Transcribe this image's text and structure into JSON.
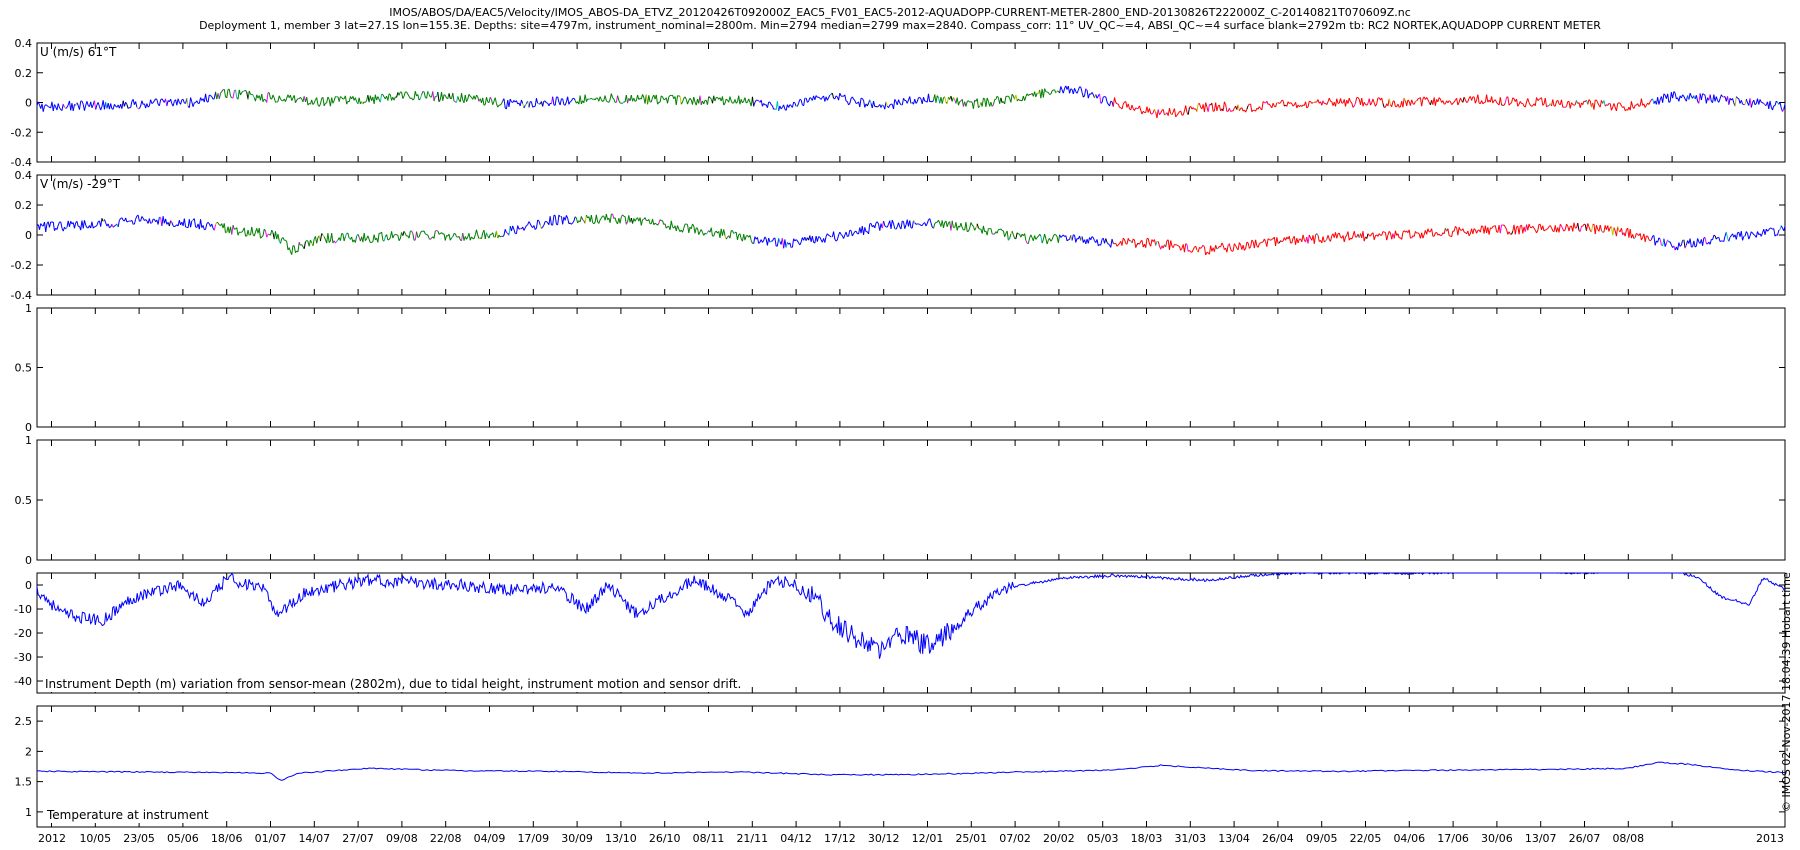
{
  "header": {
    "title_line1": "IMOS/ABOS/DA/EAC5/Velocity/IMOS_ABOS-DA_ETVZ_20120426T092000Z_EAC5_FV01_EAC5-2012-AQUADOPP-CURRENT-METER-2800_END-20130826T222000Z_C-20140821T070609Z.nc",
    "title_line2": "Deployment 1, member 3 lat=27.1S lon=155.3E. Depths: site=4797m, instrument_nominal=2800m. Min=2794 median=2799 max=2840. Compass_corr: 11° UV_QC~=4, ABSI_QC~=4 surface blank=2792m tb: RC2 NORTEK,AQUADOPP CURRENT METER"
  },
  "side_label": "© IMOS 02-Nov-2017 18:04:39 Hobart time",
  "colors": {
    "blue": "#0000ff",
    "green": "#007f00",
    "red": "#ff0000",
    "magenta": "#ff00ff",
    "cyan": "#00bfbf",
    "olive": "#bfbf00",
    "black": "#000000"
  },
  "chart_data": [
    {
      "type": "line",
      "panel": "U",
      "label": "U (m/s) 61°T",
      "xlim": [
        "2012-04-26",
        "2013-08-26"
      ],
      "ylim": [
        -0.4,
        0.4
      ],
      "yticks": [
        "0.4",
        "0.2",
        "0",
        "-0.2",
        "-0.4"
      ],
      "grid": false,
      "series": [
        {
          "color": "mixed (blue, green, red, magenta, cyan, olive, black by sample)",
          "x": [
            "2012-04-26",
            "2012-05-10",
            "2012-05-25",
            "2012-06-08",
            "2012-06-18",
            "2012-07-01",
            "2012-07-14",
            "2012-07-27",
            "2012-08-09",
            "2012-08-22",
            "2012-09-04",
            "2012-09-17",
            "2012-09-30",
            "2012-10-13",
            "2012-10-26",
            "2012-11-08",
            "2012-11-21",
            "2012-12-04",
            "2012-12-17",
            "2012-12-30",
            "2013-01-12",
            "2013-01-25",
            "2013-02-07",
            "2013-02-20",
            "2013-03-05",
            "2013-03-18",
            "2013-03-31",
            "2013-04-13",
            "2013-04-26",
            "2013-05-09",
            "2013-05-22",
            "2013-06-04",
            "2013-06-17",
            "2013-06-30",
            "2013-07-13",
            "2013-07-26",
            "2013-08-08",
            "2013-08-26"
          ],
          "values": [
            -0.03,
            -0.02,
            -0.01,
            0.0,
            0.06,
            0.03,
            0.0,
            0.02,
            0.05,
            0.03,
            -0.01,
            0.01,
            0.03,
            0.02,
            0.01,
            0.02,
            -0.03,
            0.04,
            -0.03,
            0.03,
            -0.01,
            0.03,
            0.1,
            0.0,
            -0.08,
            -0.03,
            -0.03,
            -0.01,
            0.0,
            0.0,
            0.01,
            0.02,
            0.0,
            -0.01,
            -0.03,
            0.04,
            0.02,
            -0.03
          ]
        }
      ]
    },
    {
      "type": "line",
      "panel": "V",
      "label": "V (m/s) -29°T",
      "xlim": [
        "2012-04-26",
        "2013-08-26"
      ],
      "ylim": [
        -0.4,
        0.4
      ],
      "yticks": [
        "0.4",
        "0.2",
        "0",
        "-0.2",
        "-0.4"
      ],
      "grid": false,
      "series": [
        {
          "color": "mixed (blue, green, red, magenta, cyan, olive, black by sample)",
          "x": [
            "2012-04-26",
            "2012-05-10",
            "2012-05-25",
            "2012-06-08",
            "2012-06-18",
            "2012-07-01",
            "2012-07-06",
            "2012-07-14",
            "2012-07-27",
            "2012-08-09",
            "2012-08-22",
            "2012-09-04",
            "2012-09-17",
            "2012-09-30",
            "2012-10-13",
            "2012-10-26",
            "2012-11-08",
            "2012-11-21",
            "2012-12-04",
            "2012-12-17",
            "2012-12-30",
            "2013-01-12",
            "2013-01-25",
            "2013-02-07",
            "2013-02-20",
            "2013-03-05",
            "2013-03-18",
            "2013-03-31",
            "2013-04-13",
            "2013-04-26",
            "2013-05-09",
            "2013-05-22",
            "2013-06-04",
            "2013-06-17",
            "2013-06-30",
            "2013-07-13",
            "2013-07-26",
            "2013-08-08",
            "2013-08-26"
          ],
          "values": [
            0.05,
            0.07,
            0.1,
            0.08,
            0.04,
            0.0,
            -0.1,
            -0.02,
            -0.02,
            0.0,
            -0.01,
            0.02,
            0.1,
            0.11,
            0.09,
            0.04,
            -0.01,
            -0.06,
            -0.01,
            0.06,
            0.08,
            0.05,
            -0.02,
            -0.03,
            -0.05,
            -0.06,
            -0.1,
            -0.06,
            -0.03,
            -0.01,
            0.0,
            0.02,
            0.03,
            0.04,
            0.05,
            0.02,
            -0.08,
            -0.02,
            0.03
          ]
        }
      ]
    },
    {
      "type": "line",
      "panel": "empty1",
      "xlim": [
        "2012-04-26",
        "2013-08-26"
      ],
      "ylim": [
        0,
        1
      ],
      "yticks": [
        "1",
        "0.5",
        "0"
      ],
      "grid": false,
      "series": []
    },
    {
      "type": "line",
      "panel": "empty2",
      "xlim": [
        "2012-04-26",
        "2013-08-26"
      ],
      "ylim": [
        0,
        1
      ],
      "yticks": [
        "1",
        "0.5",
        "0"
      ],
      "grid": false,
      "series": []
    },
    {
      "type": "line",
      "panel": "depth",
      "label": "Instrument Depth (m) variation from sensor-mean (2802m), due to tidal height, instrument motion and sensor drift.",
      "xlim": [
        "2012-04-26",
        "2013-08-26"
      ],
      "ylim": [
        -45,
        5
      ],
      "yticks": [
        "0",
        "-10",
        "-20",
        "-30",
        "-40"
      ],
      "grid": false,
      "series": [
        {
          "color": "blue",
          "x": [
            "2012-04-26",
            "2012-05-03",
            "2012-05-14",
            "2012-05-23",
            "2012-06-04",
            "2012-06-12",
            "2012-06-18",
            "2012-06-28",
            "2012-07-02",
            "2012-07-10",
            "2012-07-20",
            "2012-07-27",
            "2012-08-09",
            "2012-08-22",
            "2012-09-04",
            "2012-09-17",
            "2012-09-26",
            "2012-10-02",
            "2012-10-10",
            "2012-10-20",
            "2012-10-26",
            "2012-11-04",
            "2012-11-10",
            "2012-11-16",
            "2012-11-21",
            "2012-11-28",
            "2012-12-04",
            "2012-12-10",
            "2012-12-17",
            "2012-12-22",
            "2012-12-30",
            "2013-01-05",
            "2013-01-12",
            "2013-01-19",
            "2013-01-25",
            "2013-02-07",
            "2013-02-20",
            "2013-03-05",
            "2013-03-18",
            "2013-03-31",
            "2013-04-13",
            "2013-04-26",
            "2013-05-09",
            "2013-05-22",
            "2013-06-04",
            "2013-06-17",
            "2013-06-30",
            "2013-07-13",
            "2013-07-26",
            "2013-08-02",
            "2013-08-08",
            "2013-08-16",
            "2013-08-20",
            "2013-08-26"
          ],
          "values": [
            -2,
            -12,
            -15,
            -5,
            0,
            -8,
            3,
            -2,
            -12,
            -3,
            0,
            2,
            1,
            0,
            -2,
            -1,
            -10,
            0,
            -12,
            -3,
            2,
            -5,
            -12,
            0,
            2,
            -5,
            -15,
            -22,
            -28,
            -20,
            -25,
            -20,
            -10,
            -3,
            0,
            3,
            4,
            3,
            2,
            4,
            5,
            5,
            5,
            5,
            6,
            6,
            5,
            6,
            6,
            3,
            -5,
            -8,
            3,
            -2
          ]
        }
      ]
    },
    {
      "type": "line",
      "panel": "temperature",
      "label": "Temperature at instrument",
      "xlim": [
        "2012-04-26",
        "2013-08-26"
      ],
      "ylim": [
        0.75,
        2.75
      ],
      "yticks": [
        "2.5",
        "2",
        "1.5",
        "1"
      ],
      "xticks": [
        "2012",
        "10/05",
        "23/05",
        "05/06",
        "18/06",
        "01/07",
        "14/07",
        "27/07",
        "09/08",
        "22/08",
        "04/09",
        "17/09",
        "30/09",
        "13/10",
        "26/10",
        "08/11",
        "21/11",
        "04/12",
        "17/12",
        "30/12",
        "12/01",
        "25/01",
        "07/02",
        "20/02",
        "05/03",
        "18/03",
        "31/03",
        "13/04",
        "26/04",
        "09/05",
        "22/05",
        "04/06",
        "17/06",
        "30/06",
        "13/07",
        "26/07",
        "08/08",
        "2013"
      ],
      "grid": false,
      "series": [
        {
          "color": "blue",
          "x": [
            "2012-04-26",
            "2012-05-23",
            "2012-06-18",
            "2012-06-30",
            "2012-07-03",
            "2012-07-08",
            "2012-07-27",
            "2012-08-22",
            "2012-09-17",
            "2012-10-13",
            "2012-11-08",
            "2012-12-04",
            "2012-12-30",
            "2013-01-25",
            "2013-02-20",
            "2013-03-05",
            "2013-03-31",
            "2013-04-26",
            "2013-05-22",
            "2013-06-17",
            "2013-07-13",
            "2013-07-22",
            "2013-07-31",
            "2013-08-13",
            "2013-08-26"
          ],
          "values": [
            1.67,
            1.66,
            1.65,
            1.64,
            1.52,
            1.64,
            1.72,
            1.68,
            1.67,
            1.64,
            1.66,
            1.61,
            1.62,
            1.66,
            1.69,
            1.77,
            1.68,
            1.67,
            1.69,
            1.7,
            1.72,
            1.82,
            1.78,
            1.69,
            1.65
          ]
        }
      ]
    }
  ]
}
